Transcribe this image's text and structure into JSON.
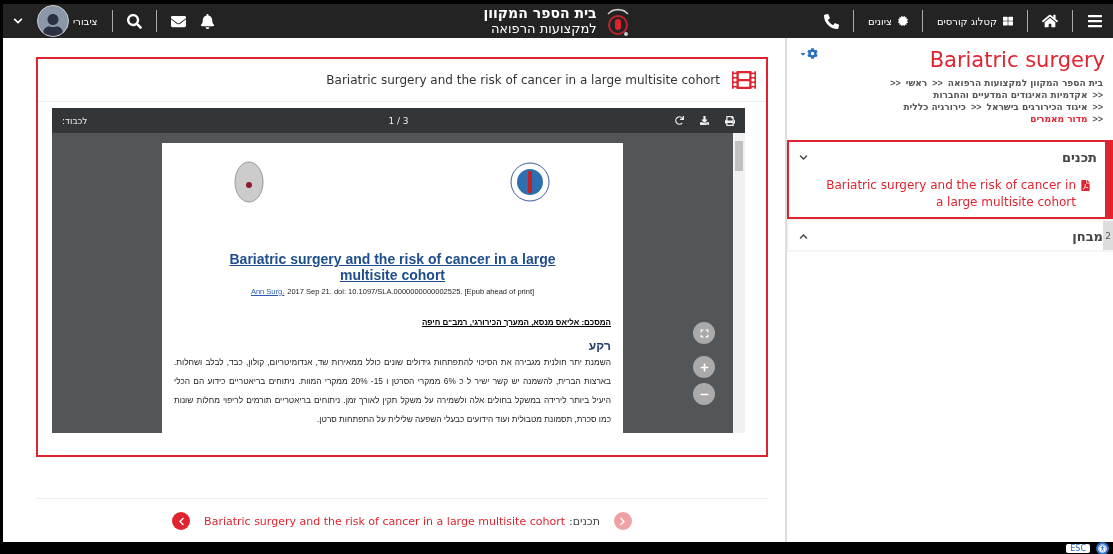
{
  "header": {
    "user_label": "ציבורי",
    "logo_line1": "בית הספר המקוון",
    "logo_line2": "למקצועות הרפואה",
    "nav": [
      {
        "kind": "catalog",
        "label": "קטלוג קורסים"
      },
      {
        "kind": "grades",
        "label": "ציונים"
      }
    ]
  },
  "viewer": {
    "title": "Bariatric surgery and the risk of cancer in a large multisite cohort",
    "pdf": {
      "recipient": "לכבוד:",
      "page": "1 / 3",
      "doc_title": "Bariatric surgery and the risk of cancer in a large multisite cohort",
      "journal": "Ann Surg.",
      "citation": "2017 Sep 21. doi: 10.1097/SLA.0000000000002525. [Epub ahead of print]",
      "summary": "המסכם: אליאס מנסא, המערך הכירורגי, רמב\"ם חיפה",
      "heading": "רקע",
      "body": "השמנת יתר חולנית מגבירה את הסיכוי להתפתחות גידולים שונים כולל ממאירות שד, אנדומיטריום, קולון, כבד, לבלב ושחלות. בארצות הברית, להשמנה יש קשר ישיר ל כ 6% ממקרי הסרטן ו 15- 20% ממקרי המוות. ניתוחים בריאטריים כידוע הם הכלי היעיל ביותר לירידה במשקל בחולים אלה ולשמירה על משקל תקין לאורך זמן. ניתוחים בריאטריים תורמים לריפוי מחלות שונות כמו סכרת, תסמונת מטבולית ועוד הידועים כבעלי השפעה שלילית על התפתחות סרטן."
    }
  },
  "footer_nav": {
    "label": "תכנים:",
    "link": "Bariatric surgery and the risk of cancer in a large multisite cohort",
    "prev_disabled": false,
    "next_disabled": true
  },
  "sidebar": {
    "title": "Bariatric surgery",
    "breadcrumb_lines": [
      [
        {
          "kind": "link",
          "text": "בית הספר המקוון למקצועות הרפואה"
        },
        {
          "kind": "sep",
          "text": ">>"
        },
        {
          "kind": "link",
          "text": "ראשי"
        },
        {
          "kind": "sep",
          "text": ">>"
        }
      ],
      [
        {
          "kind": "sep",
          "text": ">>"
        },
        {
          "kind": "link",
          "text": "אקדמיות האיגודים המדעיים והחברות"
        }
      ],
      [
        {
          "kind": "sep",
          "text": ">>"
        },
        {
          "kind": "link",
          "text": "איגוד הכירורגים בישראל"
        },
        {
          "kind": "sep",
          "text": ">>"
        },
        {
          "kind": "link",
          "text": "כירורגיה כללית"
        }
      ],
      [
        {
          "kind": "sep",
          "text": ">>"
        },
        {
          "kind": "current",
          "text": "מדור מאמרים"
        }
      ]
    ],
    "sections": [
      {
        "title": "תכנים",
        "expanded": true,
        "selected": true,
        "items": [
          {
            "label": "Bariatric surgery and the risk of cancer in a large multisite cohort"
          }
        ]
      },
      {
        "title": "מבחן",
        "expanded": false,
        "selected": false,
        "side_number": "2"
      }
    ]
  },
  "accessibility": {
    "esc_label": "ESC"
  }
}
